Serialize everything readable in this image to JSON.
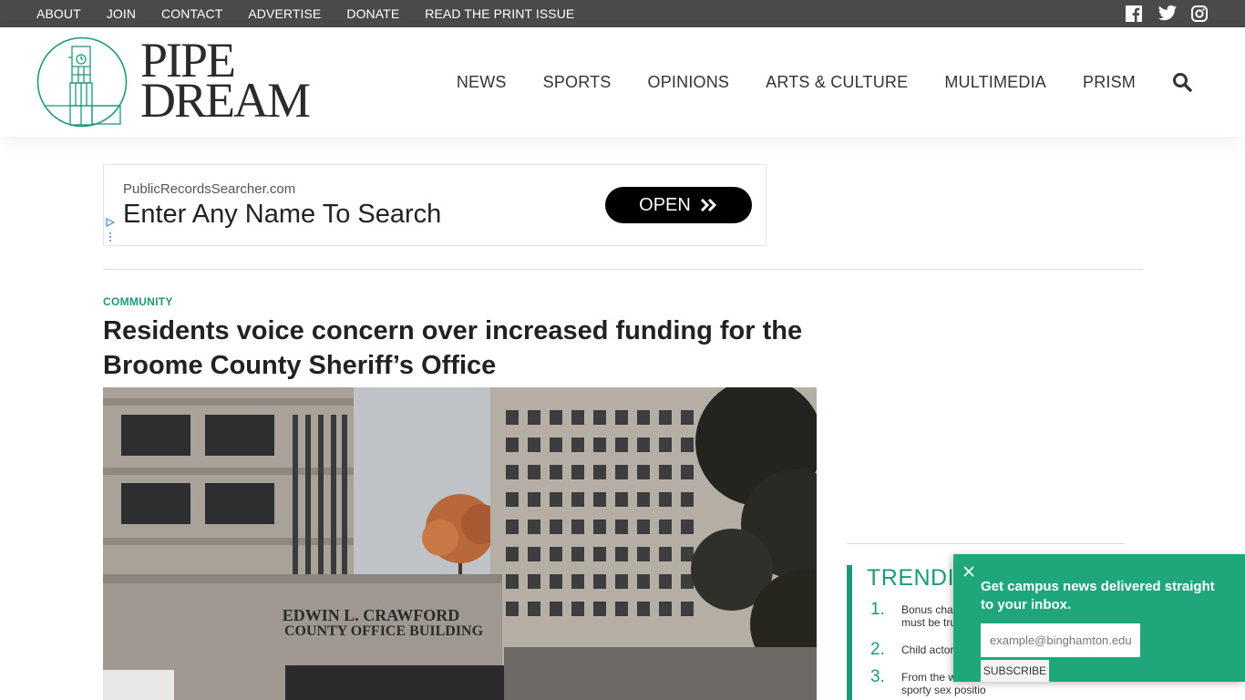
{
  "topbar": {
    "links": [
      "ABOUT",
      "JOIN",
      "CONTACT",
      "ADVERTISE",
      "DONATE",
      "READ THE PRINT ISSUE"
    ],
    "social_icons": [
      "facebook-icon",
      "twitter-icon",
      "instagram-icon"
    ]
  },
  "header": {
    "logo_line1": "PIPE",
    "logo_line2": "DREAM",
    "nav": [
      "NEWS",
      "SPORTS",
      "OPINIONS",
      "ARTS & CULTURE",
      "MULTIMEDIA",
      "PRISM"
    ],
    "search_icon": "search-icon"
  },
  "ad": {
    "domain": "PublicRecordsSearcher.com",
    "headline": "Enter Any Name To Search",
    "button": "OPEN"
  },
  "article": {
    "category": "COMMUNITY",
    "title": "Residents voice concern over increased funding for the Broome County Sheriff’s Office",
    "photo_sign_line1": "EDWIN L. CRAWFORD",
    "photo_sign_line2": "COUNTY OFFICE BUILDING"
  },
  "trending": {
    "heading": "TRENDI",
    "items": [
      {
        "num": "1.",
        "text": "Bonus chap\nmust be tru"
      },
      {
        "num": "2.",
        "text": "Child actor s"
      },
      {
        "num": "3.",
        "text": "From the wr\nsporty sex positio"
      }
    ]
  },
  "newsletter": {
    "message": "Get campus news delivered straight to your inbox.",
    "placeholder": "example@binghamton.edu",
    "button": "SUBSCRIBE"
  },
  "colors": {
    "accent": "#1a9a78",
    "popup": "#1fa77b",
    "topbar": "#4a4a4a"
  }
}
